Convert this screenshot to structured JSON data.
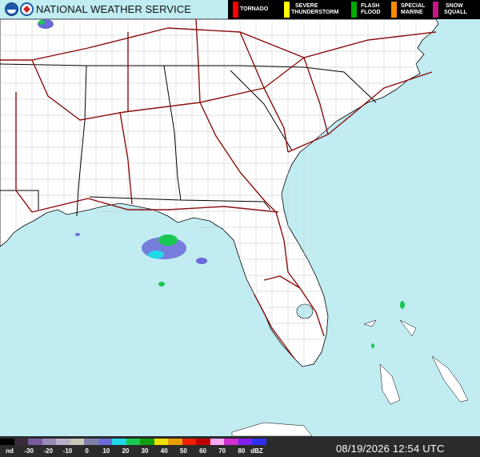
{
  "header": {
    "title": "NATIONAL WEATHER SERVICE",
    "logos": [
      "noaa-logo",
      "nws-logo"
    ]
  },
  "warning_legend": [
    {
      "label_line1": "TORNADO",
      "label_line2": "",
      "color": "#ff0000"
    },
    {
      "label_line1": "SEVERE",
      "label_line2": "THUNDERSTORM",
      "color": "#ffff00"
    },
    {
      "label_line1": "FLASH",
      "label_line2": "FLOOD",
      "color": "#00aa00"
    },
    {
      "label_line1": "SPECIAL",
      "label_line2": "MARINE",
      "color": "#ff8c00"
    },
    {
      "label_line1": "SNOW",
      "label_line2": "SQUALL",
      "color": "#c71585"
    }
  ],
  "reflectivity_scale": {
    "unit": "dBZ",
    "labels": [
      "nd",
      "-30",
      "-20",
      "-10",
      "0",
      "10",
      "20",
      "30",
      "40",
      "50",
      "60",
      "70",
      "80"
    ],
    "colors": [
      "#000000",
      "#3a2a3a",
      "#7a5a9a",
      "#9a8ab8",
      "#b8b0c8",
      "#c8c8b8",
      "#8080a8",
      "#6a6ad8",
      "#20d8e8",
      "#18c850",
      "#10a010",
      "#f0e000",
      "#e8a000",
      "#f02000",
      "#c00000",
      "#f8a8f8",
      "#d030d0",
      "#8020f0",
      "#3030f0"
    ]
  },
  "timestamp": "08/19/2026 12:54 UTC",
  "map_colors": {
    "water": "#c0ecf2",
    "land": "#ffffff",
    "county_lines": "#b8b8b8",
    "state_lines": "#000000",
    "highways": "#8b1010"
  }
}
